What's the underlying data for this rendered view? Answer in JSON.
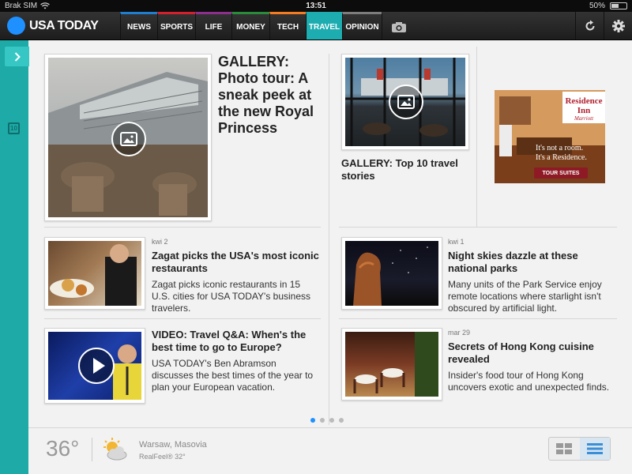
{
  "status": {
    "carrier": "Brak SIM",
    "time": "13:51",
    "battery": "50%",
    "battery_level": 0.5
  },
  "nav": {
    "brand": "USA TODAY",
    "tabs": [
      "NEWS",
      "SPORTS",
      "LIFE",
      "MONEY",
      "TECH",
      "TRAVEL",
      "OPINION"
    ],
    "active_tab": "TRAVEL",
    "accent": "#1dacaf"
  },
  "rail": {
    "calendar_day": "10"
  },
  "stories": {
    "lead": {
      "headline": "GALLERY: Photo tour: A sneak peek at the new Royal Princess"
    },
    "second": {
      "headline": "GALLERY: Top 10 travel stories"
    },
    "s1": {
      "kicker": "kwi 2",
      "headline": "Zagat picks the USA's most iconic restaurants",
      "summary": "Zagat picks iconic restaurants in 15 U.S. cities for USA TODAY's business travelers."
    },
    "s2": {
      "kicker": "kwi 1",
      "headline": "Night skies dazzle at these national parks",
      "summary": "Many units of the Park Service enjoy remote locations where starlight isn't obscured by artificial light."
    },
    "s3": {
      "headline": "VIDEO: Travel Q&A: When's the best time to go to Europe?",
      "summary": "USA TODAY's Ben Abramson discusses the best times of the year to plan your European vacation."
    },
    "s4": {
      "kicker": "mar 29",
      "headline": "Secrets of Hong Kong cuisine revealed",
      "summary": "Insider's food tour of Hong Kong uncovers exotic and unexpected finds."
    }
  },
  "ad": {
    "brand": "Residence Inn",
    "sub": "Marriott",
    "tagline1": "It's not a room.",
    "tagline2": "It's a Residence.",
    "cta": "TOUR SUITES"
  },
  "pager": {
    "pages": 4,
    "current": 1
  },
  "weather": {
    "temp": "36°",
    "location": "Warsaw, Masovia",
    "realfeel": "RealFeel® 32°",
    "icon": "partly-cloudy-icon"
  }
}
